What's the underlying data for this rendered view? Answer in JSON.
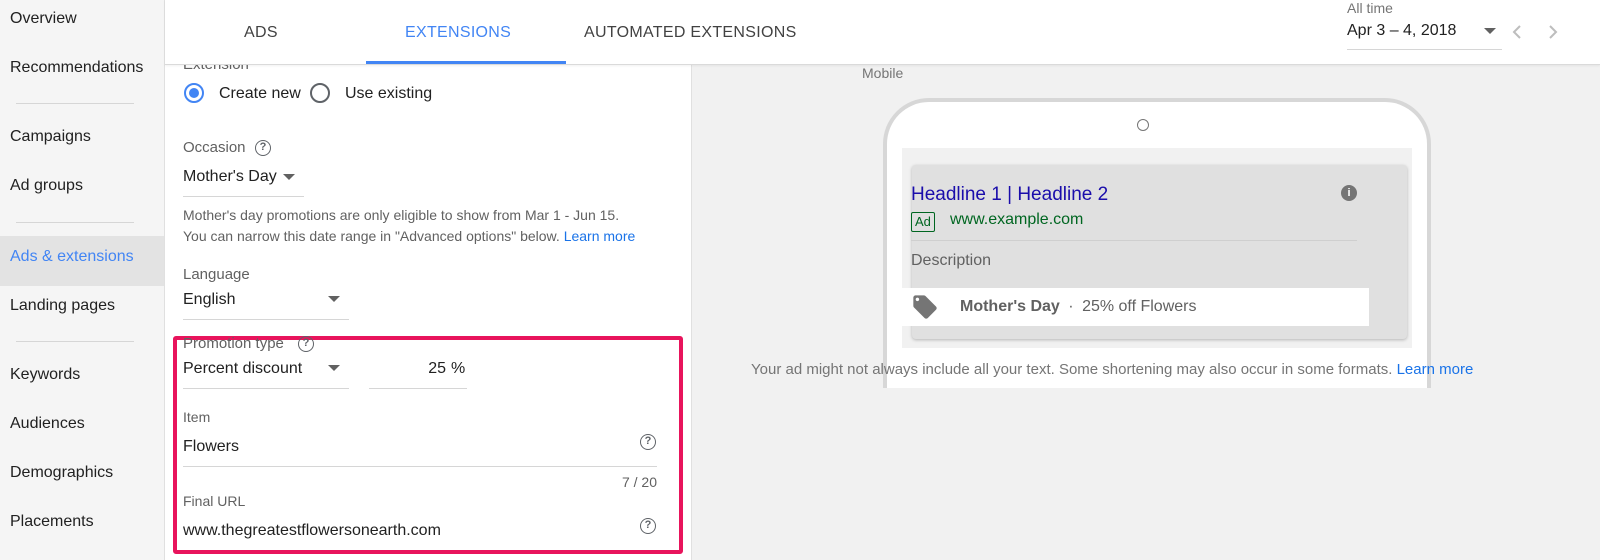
{
  "sidebar": {
    "items": [
      {
        "label": "Overview"
      },
      {
        "label": "Recommendations"
      },
      {
        "label": "Campaigns"
      },
      {
        "label": "Ad groups"
      },
      {
        "label": "Ads & extensions"
      },
      {
        "label": "Landing pages"
      },
      {
        "label": "Keywords"
      },
      {
        "label": "Audiences"
      },
      {
        "label": "Demographics"
      },
      {
        "label": "Placements"
      }
    ],
    "active_index": 4
  },
  "tabs": [
    {
      "label": "ADS"
    },
    {
      "label": "EXTENSIONS",
      "active": true
    },
    {
      "label": "AUTOMATED EXTENSIONS"
    }
  ],
  "date_range": {
    "caption": "All time",
    "value": "Apr 3 – 4, 2018"
  },
  "form": {
    "section_label_partial": "Extension",
    "radio_create": "Create new",
    "radio_existing": "Use existing",
    "occasion_label": "Occasion",
    "occasion_value": "Mother's Day",
    "occasion_note_line1": "Mother's day promotions are only eligible to show from Mar 1 - Jun 15.",
    "occasion_note_line2": "You can narrow this date range in \"Advanced options\" below.",
    "learn_more": "Learn more",
    "language_label": "Language",
    "language_value": "English",
    "promotion_type_label": "Promotion type",
    "promotion_type_value": "Percent discount",
    "percent_value": "25",
    "percent_suffix": "%",
    "item_label": "Item",
    "item_value": "Flowers",
    "item_counter": "7 / 20",
    "final_url_label": "Final URL",
    "final_url_value": "www.thegreatestflowersonearth.com"
  },
  "preview": {
    "device_label": "Mobile",
    "headline": "Headline 1 | Headline 2",
    "ad_badge": "Ad",
    "display_url": "www.example.com",
    "description": "Description",
    "promo_occasion": "Mother's Day",
    "promo_separator": "·",
    "promo_text": "25% off Flowers",
    "disclaimer": "Your ad might not always include all your text. Some shortening may also occur in some formats.",
    "learn_more": "Learn more"
  },
  "colors": {
    "accent": "#4285f4",
    "highlight": "#e8145c",
    "headline": "#1a0dab",
    "url": "#006621"
  },
  "icons": [
    "help-icon",
    "chevron-down-icon",
    "chevron-left-icon",
    "chevron-right-icon",
    "info-icon",
    "tag-icon"
  ]
}
